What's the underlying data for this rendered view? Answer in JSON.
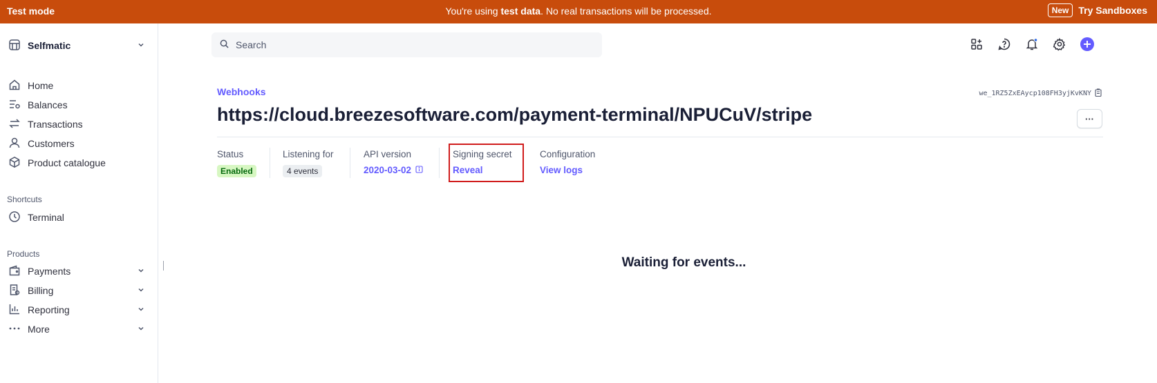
{
  "banner": {
    "mode": "Test mode",
    "msg_pre": "You're using ",
    "msg_bold": "test data",
    "msg_post": ". No real transactions will be processed.",
    "new_badge": "New",
    "try_sandboxes": "Try Sandboxes",
    "color": "#c84c0c"
  },
  "sidebar": {
    "account": "Selfmatic",
    "items": [
      {
        "label": "Home",
        "icon": "home-icon"
      },
      {
        "label": "Balances",
        "icon": "balances-icon"
      },
      {
        "label": "Transactions",
        "icon": "transactions-icon"
      },
      {
        "label": "Customers",
        "icon": "customers-icon"
      },
      {
        "label": "Product catalogue",
        "icon": "product-catalogue-icon"
      }
    ],
    "shortcuts_label": "Shortcuts",
    "shortcuts": [
      {
        "label": "Terminal",
        "icon": "clock-icon"
      }
    ],
    "products_label": "Products",
    "products": [
      {
        "label": "Payments",
        "icon": "wallet-icon"
      },
      {
        "label": "Billing",
        "icon": "billing-icon"
      },
      {
        "label": "Reporting",
        "icon": "reporting-icon"
      },
      {
        "label": "More",
        "icon": "more-dots-icon"
      }
    ]
  },
  "search": {
    "placeholder": "Search"
  },
  "accent": "#635bff",
  "page": {
    "breadcrumb": "Webhooks",
    "webhook_id": "we_1RZ5ZxEAycp108FH3yjKvKNY",
    "title": "https://cloud.breezesoftware.com/payment-terminal/NPUCuV/stripe",
    "more_label": "···",
    "stats": {
      "status_label": "Status",
      "status_value": "Enabled",
      "listening_label": "Listening for",
      "listening_value": "4 events",
      "api_label": "API version",
      "api_value": "2020-03-02",
      "secret_label": "Signing secret",
      "secret_value": "Reveal",
      "config_label": "Configuration",
      "config_value": "View logs"
    },
    "waiting": "Waiting for events..."
  }
}
